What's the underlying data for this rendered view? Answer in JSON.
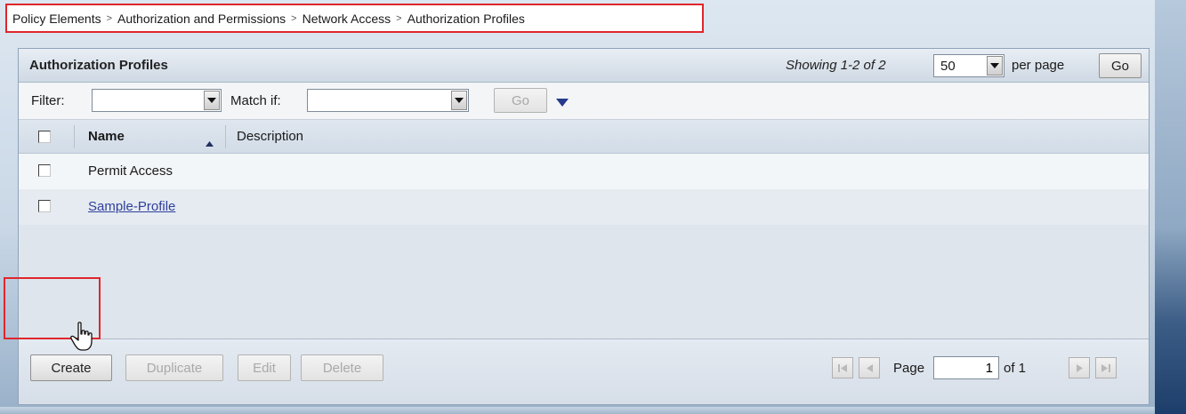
{
  "breadcrumb": {
    "items": [
      "Policy Elements",
      "Authorization and Permissions",
      "Network Access",
      "Authorization Profiles"
    ],
    "separator": ">"
  },
  "panel": {
    "title": "Authorization Profiles",
    "showing": "Showing 1-2 of 2",
    "per_page_value": "50",
    "per_page_label": "per page",
    "go_label": "Go"
  },
  "filter": {
    "filter_label": "Filter:",
    "filter_value": "",
    "match_label": "Match if:",
    "match_value": "",
    "go_label": "Go"
  },
  "table": {
    "columns": [
      "Name",
      "Description"
    ],
    "rows": [
      {
        "name": "Permit Access",
        "description": "",
        "is_link": false
      },
      {
        "name": "Sample-Profile",
        "description": "",
        "is_link": true
      }
    ]
  },
  "actions": {
    "create": "Create",
    "duplicate": "Duplicate",
    "edit": "Edit",
    "delete": "Delete"
  },
  "pagination": {
    "page_label": "Page",
    "current_page": "1",
    "of_label": "of 1"
  },
  "colors": {
    "highlight_border": "#e0262c",
    "link": "#2f3f9c",
    "disabled_text": "#a9a9a9"
  }
}
